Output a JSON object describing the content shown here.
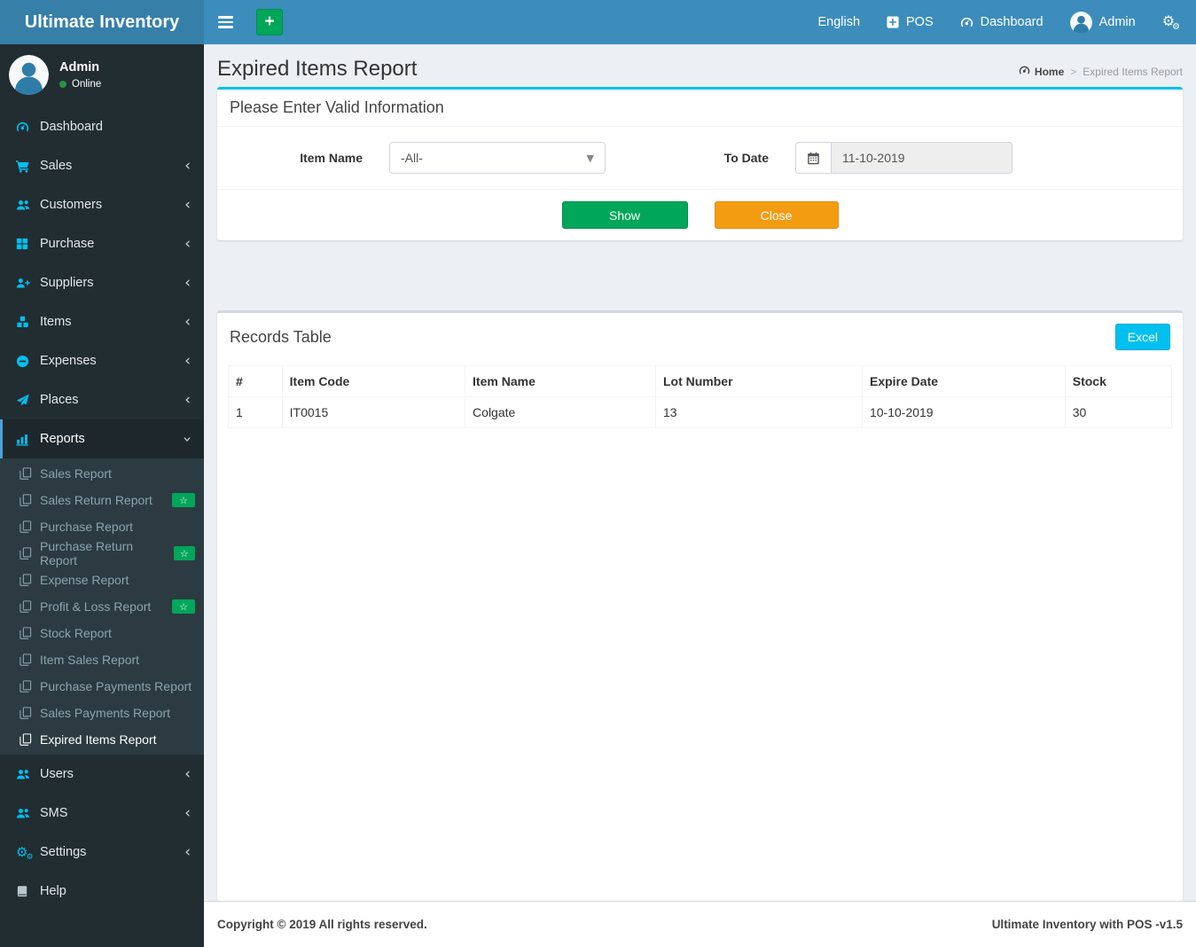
{
  "topbar": {
    "logo": "Ultimate Inventory",
    "language": "English",
    "pos_label": "POS",
    "dashboard_label": "Dashboard",
    "user_name": "Admin"
  },
  "sidebar": {
    "user": {
      "name": "Admin",
      "status": "Online"
    },
    "menu": [
      {
        "label": "Dashboard",
        "icon": "gauge",
        "chevron": false
      },
      {
        "label": "Sales",
        "icon": "cart",
        "chevron": true
      },
      {
        "label": "Customers",
        "icon": "users",
        "chevron": true
      },
      {
        "label": "Purchase",
        "icon": "grid",
        "chevron": true
      },
      {
        "label": "Suppliers",
        "icon": "user-plus",
        "chevron": true
      },
      {
        "label": "Items",
        "icon": "cubes",
        "chevron": true
      },
      {
        "label": "Expenses",
        "icon": "minus-circle",
        "chevron": true
      },
      {
        "label": "Places",
        "icon": "paper-plane",
        "chevron": true
      },
      {
        "label": "Reports",
        "icon": "bar-chart",
        "chevron": "down",
        "active": true,
        "submenu": [
          {
            "label": "Sales Report"
          },
          {
            "label": "Sales Return Report",
            "badge": "star"
          },
          {
            "label": "Purchase Report"
          },
          {
            "label": "Purchase Return Report",
            "badge": "star"
          },
          {
            "label": "Expense Report"
          },
          {
            "label": "Profit & Loss Report",
            "badge": "star"
          },
          {
            "label": "Stock Report"
          },
          {
            "label": "Item Sales Report"
          },
          {
            "label": "Purchase Payments Report"
          },
          {
            "label": "Sales Payments Report"
          },
          {
            "label": "Expired Items Report",
            "active": true
          }
        ]
      },
      {
        "label": "Users",
        "icon": "users",
        "chevron": true
      },
      {
        "label": "SMS",
        "icon": "users",
        "chevron": true
      },
      {
        "label": "Settings",
        "icon": "gears",
        "chevron": true
      },
      {
        "label": "Help",
        "icon": "book",
        "chevron": false,
        "icon_gray": true
      }
    ]
  },
  "main": {
    "title": "Expired Items Report",
    "breadcrumb": {
      "home": "Home",
      "separator": ">",
      "current": "Expired Items Report"
    }
  },
  "filter": {
    "title": "Please Enter Valid Information",
    "item_name_label": "Item Name",
    "item_name_value": "-All-",
    "to_date_label": "To Date",
    "to_date_value": "11-10-2019",
    "show_label": "Show",
    "close_label": "Close"
  },
  "records": {
    "title": "Records Table",
    "excel_label": "Excel",
    "columns": [
      "#",
      "Item Code",
      "Item Name",
      "Lot Number",
      "Expire Date",
      "Stock"
    ],
    "rows": [
      [
        "1",
        "IT0015",
        "Colgate",
        "13",
        "10-10-2019",
        "30"
      ]
    ]
  },
  "footer": {
    "left": "Copyright © 2019 All rights reserved.",
    "right": "Ultimate Inventory with POS -v1.5"
  },
  "colors": {
    "navbar": "#3c8dbc",
    "logo_bg": "#367fa9",
    "sidebar_bg": "#222d32",
    "submenu_bg": "#2c3b41",
    "accent_cyan": "#00c0ef",
    "green": "#00a65a",
    "orange": "#f39c12",
    "content_bg": "#ecf0f5"
  }
}
